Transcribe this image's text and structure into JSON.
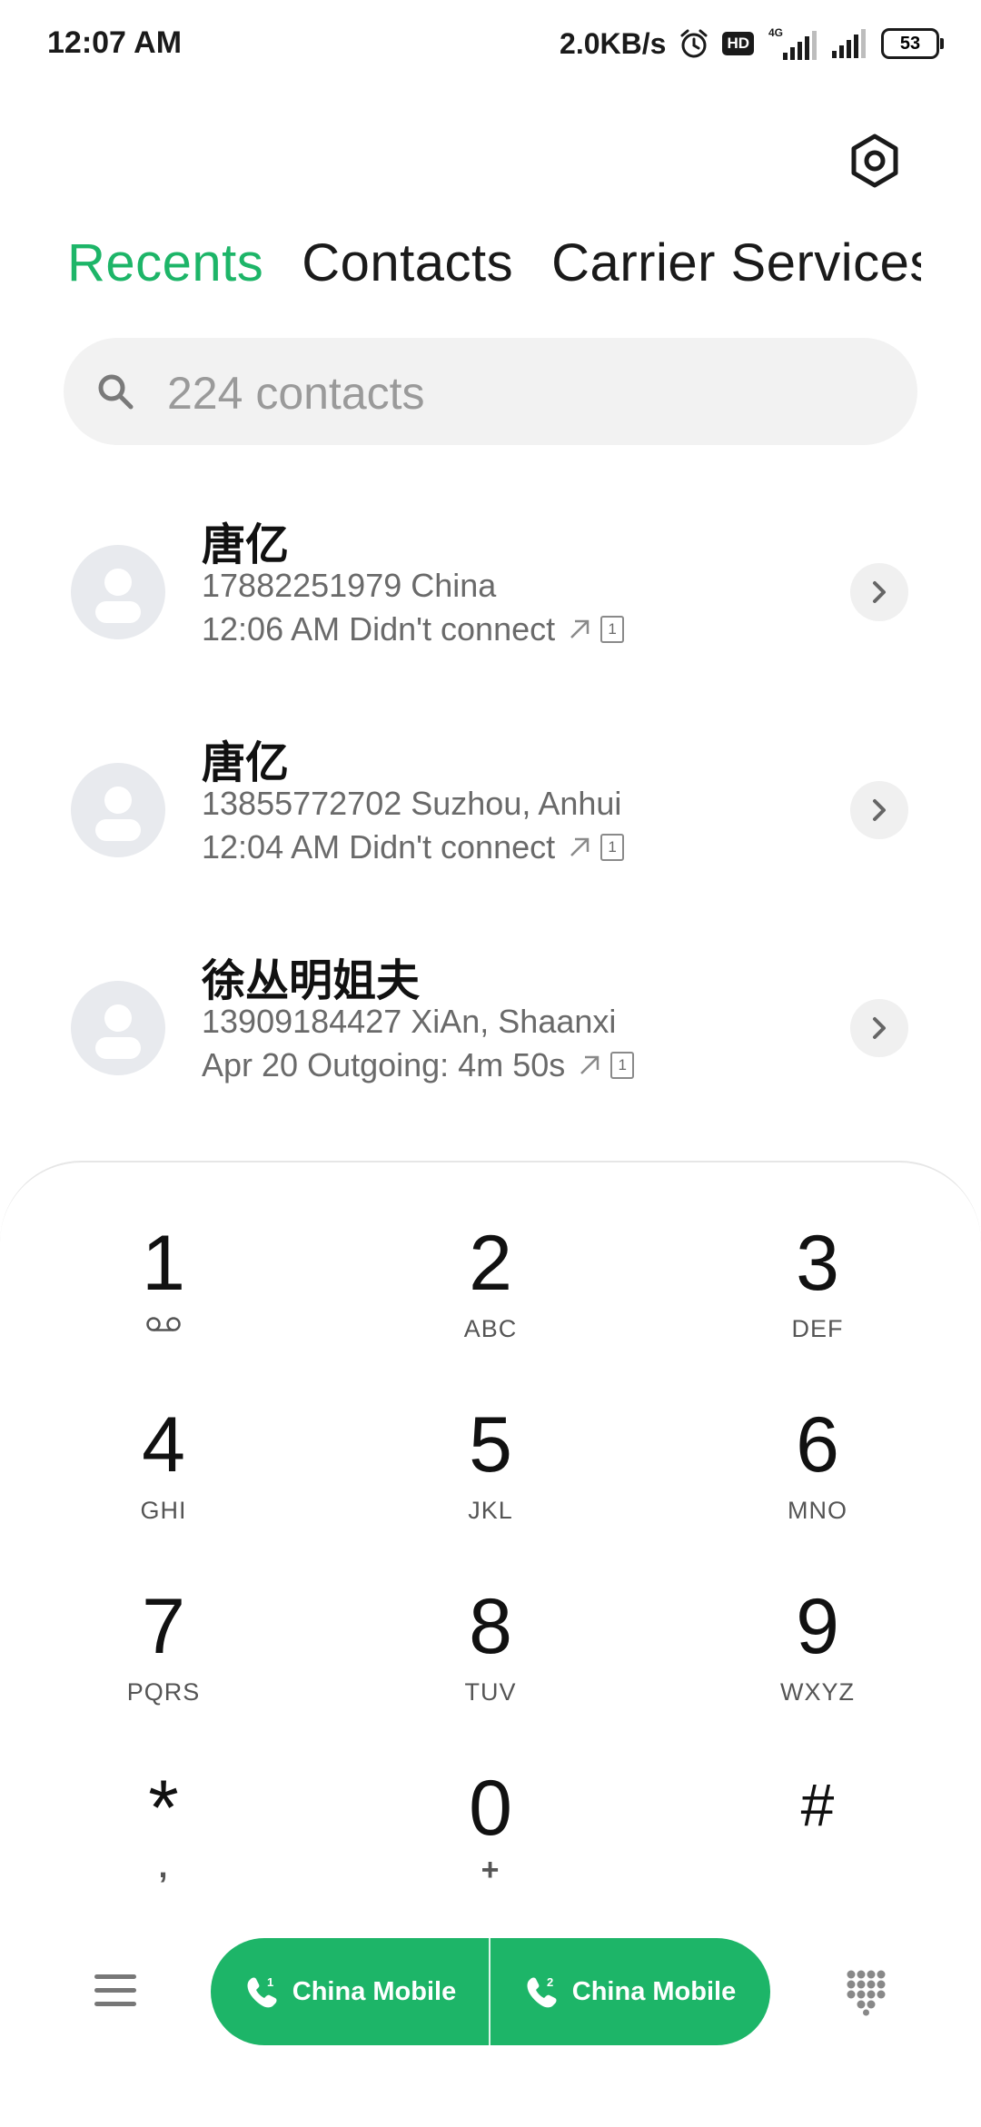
{
  "status_bar": {
    "time": "12:07 AM",
    "net_speed": "2.0KB/s",
    "hd_label": "HD",
    "network_type": "4G",
    "battery": "53"
  },
  "tabs": [
    {
      "label": "Recents",
      "active": true
    },
    {
      "label": "Contacts",
      "active": false
    },
    {
      "label": "Carrier Services",
      "active": false
    }
  ],
  "search": {
    "placeholder": "224 contacts"
  },
  "recents": [
    {
      "name": "唐亿",
      "number": "17882251979",
      "location": "China",
      "line2": "17882251979  China",
      "time": "12:06 AM",
      "status": "Didn't connect",
      "line3": "12:06 AM Didn't connect",
      "sim": "1"
    },
    {
      "name": "唐亿",
      "number": "13855772702",
      "location": "Suzhou, Anhui",
      "line2": "13855772702  Suzhou, Anhui",
      "time": "12:04 AM",
      "status": "Didn't connect",
      "line3": "12:04 AM Didn't connect",
      "sim": "1"
    },
    {
      "name": "徐丛明姐夫",
      "number": "13909184427",
      "location": "XiAn, Shaanxi",
      "line2": "13909184427  XiAn, Shaanxi",
      "time": "Apr 20",
      "status": "Outgoing: 4m 50s",
      "line3": "Apr 20 Outgoing: 4m 50s",
      "sim": "1"
    }
  ],
  "keypad": [
    {
      "digit": "1",
      "letters": ""
    },
    {
      "digit": "2",
      "letters": "ABC"
    },
    {
      "digit": "3",
      "letters": "DEF"
    },
    {
      "digit": "4",
      "letters": "GHI"
    },
    {
      "digit": "5",
      "letters": "JKL"
    },
    {
      "digit": "6",
      "letters": "MNO"
    },
    {
      "digit": "7",
      "letters": "PQRS"
    },
    {
      "digit": "8",
      "letters": "TUV"
    },
    {
      "digit": "9",
      "letters": "WXYZ"
    },
    {
      "digit": "*",
      "letters": ","
    },
    {
      "digit": "0",
      "letters": "+"
    },
    {
      "digit": "#",
      "letters": ""
    }
  ],
  "call_buttons": [
    {
      "sim": "1",
      "label": "China Mobile"
    },
    {
      "sim": "2",
      "label": "China Mobile"
    }
  ],
  "colors": {
    "accent": "#1db568",
    "text": "#111111",
    "secondary": "#6a6a6a",
    "search_bg": "#f2f2f2"
  }
}
